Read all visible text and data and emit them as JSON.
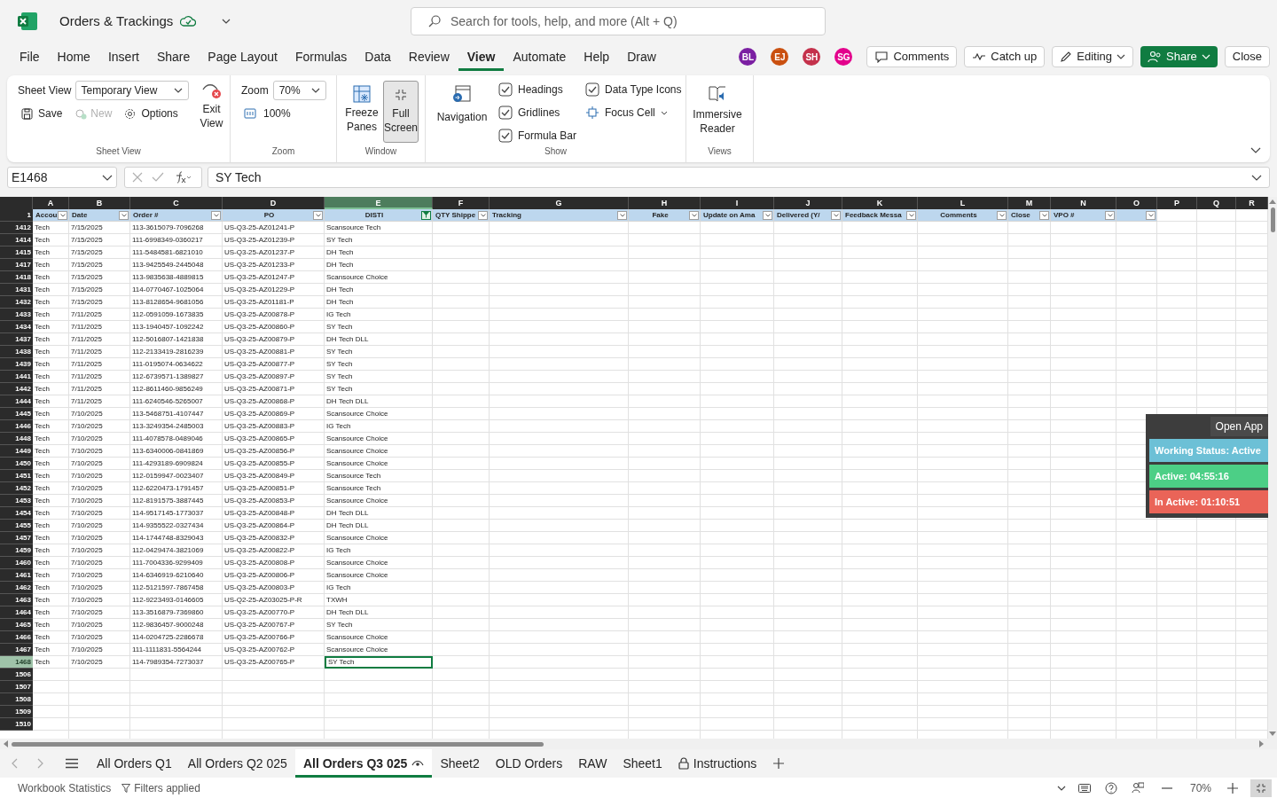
{
  "title_bar": {
    "file_name": "Orders & Trackings",
    "search_placeholder": "Search for tools, help, and more (Alt + Q)"
  },
  "menu": [
    {
      "label": "File",
      "selected": false
    },
    {
      "label": "Home",
      "selected": false
    },
    {
      "label": "Insert",
      "selected": false
    },
    {
      "label": "Share",
      "selected": false
    },
    {
      "label": "Page Layout",
      "selected": false
    },
    {
      "label": "Formulas",
      "selected": false
    },
    {
      "label": "Data",
      "selected": false
    },
    {
      "label": "Review",
      "selected": false
    },
    {
      "label": "View",
      "selected": true
    },
    {
      "label": "Automate",
      "selected": false
    },
    {
      "label": "Help",
      "selected": false
    },
    {
      "label": "Draw",
      "selected": false
    }
  ],
  "collaborators": [
    {
      "initials": "BL",
      "color": "#7b1fa2"
    },
    {
      "initials": "EJ",
      "color": "#ca5010"
    },
    {
      "initials": "SH",
      "color": "#c4314b"
    },
    {
      "initials": "SG",
      "color": "#e3008c"
    }
  ],
  "actions": {
    "comments": "Comments",
    "catch_up": "Catch up",
    "editing": "Editing",
    "share": "Share",
    "close": "Close"
  },
  "ribbon": {
    "sheet_view": {
      "label": "Sheet View",
      "view": "Temporary View",
      "save": "Save",
      "new": {
        "label": "New",
        "disabled": true
      },
      "options": "Options",
      "exit": "Exit View",
      "group": "Sheet View"
    },
    "zoom": {
      "label": "Zoom",
      "value": "70%",
      "reset": "100%",
      "group": "Zoom"
    },
    "window": {
      "freeze": "Freeze Panes",
      "full_screen": {
        "label": "Full Screen",
        "pressed": true
      },
      "group": "Window"
    },
    "show": {
      "navigation": "Navigation",
      "checks": [
        {
          "label": "Headings",
          "checked": true
        },
        {
          "label": "Gridlines",
          "checked": true
        },
        {
          "label": "Formula Bar",
          "checked": true
        },
        {
          "label": "Data Type Icons",
          "checked": true
        }
      ],
      "focus_cell": "Focus Cell",
      "group": "Show"
    },
    "views": {
      "immersive": "Immersive Reader",
      "group": "Views"
    }
  },
  "formula_bar": {
    "name_box": "E1468",
    "formula": "SY Tech"
  },
  "table": {
    "header_row_number": "1",
    "columns": [
      {
        "letter": "A",
        "header": "Accou",
        "filter": true,
        "filtered": false,
        "selected": false
      },
      {
        "letter": "B",
        "header": "Date",
        "filter": true,
        "filtered": false,
        "selected": false
      },
      {
        "letter": "C",
        "header": "Order #",
        "filter": true,
        "filtered": false,
        "selected": false
      },
      {
        "letter": "D",
        "header": "PO",
        "filter": true,
        "filtered": false,
        "selected": false
      },
      {
        "letter": "E",
        "header": "DISTI",
        "filter": true,
        "filtered": true,
        "selected": true
      },
      {
        "letter": "F",
        "header": "QTY Shippe",
        "filter": true,
        "filtered": false,
        "selected": false
      },
      {
        "letter": "G",
        "header": "Tracking",
        "filter": true,
        "filtered": false,
        "selected": false
      },
      {
        "letter": "H",
        "header": "Fake",
        "filter": true,
        "filtered": false,
        "selected": false
      },
      {
        "letter": "I",
        "header": "Update on Ama",
        "filter": true,
        "filtered": false,
        "selected": false
      },
      {
        "letter": "J",
        "header": "Delivered (Y/",
        "filter": true,
        "filtered": false,
        "selected": false
      },
      {
        "letter": "K",
        "header": "Feedback Messa",
        "filter": true,
        "filtered": false,
        "selected": false
      },
      {
        "letter": "L",
        "header": "Comments",
        "filter": true,
        "filtered": false,
        "selected": false
      },
      {
        "letter": "M",
        "header": "Close",
        "filter": true,
        "filtered": false,
        "selected": false
      },
      {
        "letter": "N",
        "header": "VPO #",
        "filter": true,
        "filtered": false,
        "selected": false
      },
      {
        "letter": "O",
        "filter": true,
        "filtered": false,
        "selected": false
      },
      {
        "letter": "P",
        "filter": false,
        "selected": false
      },
      {
        "letter": "Q",
        "filter": false,
        "selected": false
      },
      {
        "letter": "R",
        "filter": false,
        "selected": false
      }
    ],
    "rows": [
      {
        "number": "1412",
        "selected": false,
        "cells": [
          "Tech",
          "7/15/2025",
          "113-3615079-7096268",
          "US-Q3-25-AZ01241-P",
          "Scansource Tech"
        ]
      },
      {
        "number": "1414",
        "selected": false,
        "cells": [
          "Tech",
          "7/15/2025",
          "111-6998349-0360217",
          "US-Q3-25-AZ01239-P",
          "SY Tech"
        ]
      },
      {
        "number": "1415",
        "selected": false,
        "cells": [
          "Tech",
          "7/15/2025",
          "111-5484581-6821010",
          "US-Q3-25-AZ01237-P",
          "DH Tech"
        ]
      },
      {
        "number": "1417",
        "selected": false,
        "cells": [
          "Tech",
          "7/15/2025",
          "113-9425549-2445048",
          "US-Q3-25-AZ01233-P",
          "DH Tech"
        ]
      },
      {
        "number": "1418",
        "selected": false,
        "cells": [
          "Tech",
          "7/15/2025",
          "113-9835638-4889815",
          "US-Q3-25-AZ01247-P",
          "Scansource Choice"
        ]
      },
      {
        "number": "1431",
        "selected": false,
        "cells": [
          "Tech",
          "7/15/2025",
          "114-0770467-1025064",
          "US-Q3-25-AZ01229-P",
          "DH Tech"
        ]
      },
      {
        "number": "1432",
        "selected": false,
        "cells": [
          "Tech",
          "7/15/2025",
          "113-8128654-9681056",
          "US-Q3-25-AZ01181-P",
          "DH Tech"
        ]
      },
      {
        "number": "1433",
        "selected": false,
        "cells": [
          "Tech",
          "7/11/2025",
          "112-0591059-1673835",
          "US-Q3-25-AZ00878-P",
          "IG Tech"
        ]
      },
      {
        "number": "1434",
        "selected": false,
        "cells": [
          "Tech",
          "7/11/2025",
          "113-1940457-1092242",
          "US-Q3-25-AZ00860-P",
          "SY Tech"
        ]
      },
      {
        "number": "1437",
        "selected": false,
        "cells": [
          "Tech",
          "7/11/2025",
          "112-5016807-1421838",
          "US-Q3-25-AZ00879-P",
          "DH Tech DLL"
        ]
      },
      {
        "number": "1438",
        "selected": false,
        "cells": [
          "Tech",
          "7/11/2025",
          "112-2133419-2816239",
          "US-Q3-25-AZ00881-P",
          "SY Tech"
        ]
      },
      {
        "number": "1439",
        "selected": false,
        "cells": [
          "Tech",
          "7/11/2025",
          "111-0195074-0634622",
          "US-Q3-25-AZ00877-P",
          "SY Tech"
        ]
      },
      {
        "number": "1441",
        "selected": false,
        "cells": [
          "Tech",
          "7/11/2025",
          "112-6739571-1389827",
          "US-Q3-25-AZ00897-P",
          "SY Tech"
        ]
      },
      {
        "number": "1442",
        "selected": false,
        "cells": [
          "Tech",
          "7/11/2025",
          "112-8611460-9856249",
          "US-Q3-25-AZ00871-P",
          "SY Tech"
        ]
      },
      {
        "number": "1444",
        "selected": false,
        "cells": [
          "Tech",
          "7/11/2025",
          "111-6240546-5265007",
          "US-Q3-25-AZ00868-P",
          "DH Tech DLL"
        ]
      },
      {
        "number": "1445",
        "selected": false,
        "cells": [
          "Tech",
          "7/10/2025",
          "113-5468751-4107447",
          "US-Q3-25-AZ00869-P",
          "Scansource Choice"
        ]
      },
      {
        "number": "1446",
        "selected": false,
        "cells": [
          "Tech",
          "7/10/2025",
          "113-3249354-2485003",
          "US-Q3-25-AZ00883-P",
          "IG Tech"
        ]
      },
      {
        "number": "1448",
        "selected": false,
        "cells": [
          "Tech",
          "7/10/2025",
          "111-4078578-0489046",
          "US-Q3-25-AZ00865-P",
          "Scansource Choice"
        ]
      },
      {
        "number": "1449",
        "selected": false,
        "cells": [
          "Tech",
          "7/10/2025",
          "113-6340006-0841869",
          "US-Q3-25-AZ00856-P",
          "Scansource Choice"
        ]
      },
      {
        "number": "1450",
        "selected": false,
        "cells": [
          "Tech",
          "7/10/2025",
          "111-4293189-6909824",
          "US-Q3-25-AZ00855-P",
          "Scansource Choice"
        ]
      },
      {
        "number": "1451",
        "selected": false,
        "cells": [
          "Tech",
          "7/10/2025",
          "112-0159947-0023407",
          "US-Q3-25-AZ00849-P",
          "Scansource Tech"
        ]
      },
      {
        "number": "1452",
        "selected": false,
        "cells": [
          "Tech",
          "7/10/2025",
          "112-6220473-1791457",
          "US-Q3-25-AZ00851-P",
          "Scansource Tech"
        ]
      },
      {
        "number": "1453",
        "selected": false,
        "cells": [
          "Tech",
          "7/10/2025",
          "112-8191575-3887445",
          "US-Q3-25-AZ00853-P",
          "Scansource Choice"
        ]
      },
      {
        "number": "1454",
        "selected": false,
        "cells": [
          "Tech",
          "7/10/2025",
          "114-9517145-1773037",
          "US-Q3-25-AZ00848-P",
          "DH Tech DLL"
        ]
      },
      {
        "number": "1455",
        "selected": false,
        "cells": [
          "Tech",
          "7/10/2025",
          "114-9355522-0327434",
          "US-Q3-25-AZ00864-P",
          "DH Tech DLL"
        ]
      },
      {
        "number": "1457",
        "selected": false,
        "cells": [
          "Tech",
          "7/10/2025",
          "114-1744748-8329043",
          "US-Q3-25-AZ00832-P",
          "Scansource Choice"
        ]
      },
      {
        "number": "1459",
        "selected": false,
        "cells": [
          "Tech",
          "7/10/2025",
          "112-0429474-3821069",
          "US-Q3-25-AZ00822-P",
          "IG Tech"
        ]
      },
      {
        "number": "1460",
        "selected": false,
        "cells": [
          "Tech",
          "7/10/2025",
          "111-7004336-9299409",
          "US-Q3-25-AZ00808-P",
          "Scansource Choice"
        ]
      },
      {
        "number": "1461",
        "selected": false,
        "cells": [
          "Tech",
          "7/10/2025",
          "114-6346919-6210640",
          "US-Q3-25-AZ00806-P",
          "Scansource Choice"
        ]
      },
      {
        "number": "1462",
        "selected": false,
        "cells": [
          "Tech",
          "7/10/2025",
          "112-5121597-7867458",
          "US-Q3-25-AZ00803-P",
          "IG Tech"
        ]
      },
      {
        "number": "1463",
        "selected": false,
        "cells": [
          "Tech",
          "7/10/2025",
          "112-9223493-0146605",
          "US-Q2-25-AZ03025-P-R",
          "TXWH"
        ]
      },
      {
        "number": "1464",
        "selected": false,
        "cells": [
          "Tech",
          "7/10/2025",
          "113-3516879-7369860",
          "US-Q3-25-AZ00770-P",
          "DH Tech DLL"
        ]
      },
      {
        "number": "1465",
        "selected": false,
        "cells": [
          "Tech",
          "7/10/2025",
          "112-9836457-9000248",
          "US-Q3-25-AZ00767-P",
          "SY Tech"
        ]
      },
      {
        "number": "1466",
        "selected": false,
        "cells": [
          "Tech",
          "7/10/2025",
          "114-0204725-2286678",
          "US-Q3-25-AZ00766-P",
          "Scansource Choice"
        ]
      },
      {
        "number": "1467",
        "selected": false,
        "cells": [
          "Tech",
          "7/10/2025",
          "111-1111831-5564244",
          "US-Q3-25-AZ00762-P",
          "Scansource Choice"
        ]
      },
      {
        "number": "1468",
        "selected": true,
        "cells": [
          "Tech",
          "7/10/2025",
          "114-7989354-7273037",
          "US-Q3-25-AZ00765-P",
          "SY Tech"
        ]
      },
      {
        "number": "1506",
        "selected": false
      },
      {
        "number": "1507",
        "selected": false
      },
      {
        "number": "1508",
        "selected": false
      },
      {
        "number": "1509",
        "selected": false
      },
      {
        "number": "1510",
        "selected": false
      }
    ]
  },
  "status_panel": {
    "open_app": "Open App",
    "items": [
      {
        "label": "Working Status: Active",
        "color": "#6cc0d6"
      },
      {
        "label": "Active: 04:55:16",
        "color": "#4ccf86"
      },
      {
        "label": "In Active: 01:10:51",
        "color": "#ea6458"
      }
    ]
  },
  "sheet_tabs": [
    {
      "label": "All Orders Q1",
      "selected": false,
      "kind": "plain"
    },
    {
      "label": "All Orders Q2 025",
      "selected": false,
      "kind": "plain"
    },
    {
      "label": "All Orders Q3 025",
      "selected": true,
      "kind": "sheet_view"
    },
    {
      "label": "Sheet2",
      "selected": false,
      "kind": "plain"
    },
    {
      "label": "OLD Orders",
      "selected": false,
      "kind": "plain"
    },
    {
      "label": "RAW",
      "selected": false,
      "kind": "plain"
    },
    {
      "label": "Sheet1",
      "selected": false,
      "kind": "plain"
    },
    {
      "label": "Instructions",
      "selected": false,
      "kind": "locked"
    }
  ],
  "status_bar": {
    "statistics": "Workbook Statistics",
    "filters": "Filters applied",
    "zoom": "70%"
  }
}
